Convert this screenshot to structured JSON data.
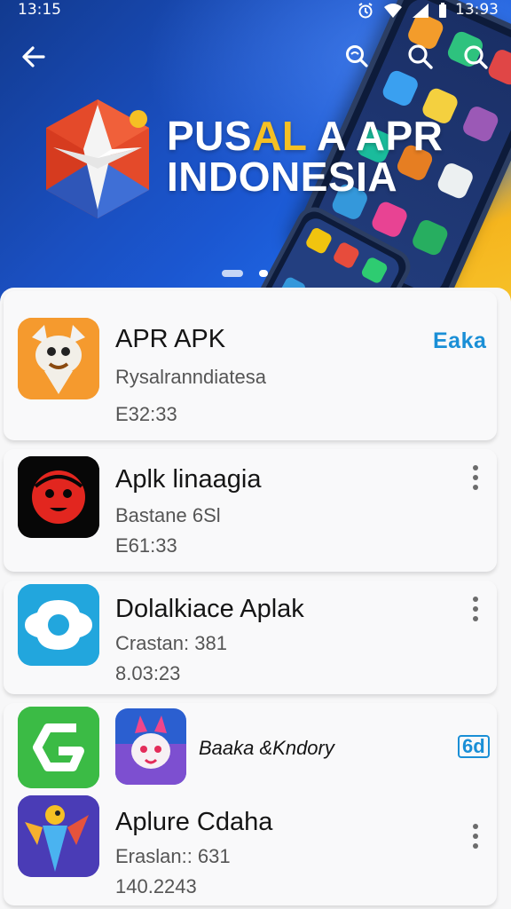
{
  "status_bar": {
    "time_left": "13:15",
    "time_right": "13:93"
  },
  "hero": {
    "title_line1_pre": "PUS",
    "title_line1_hl": "AL",
    "title_line1_post": " A APR",
    "title_line2": "INDONESIA"
  },
  "apps": [
    {
      "name": "APR APK",
      "subtitle": "Rysalranndiatesa",
      "meta": "Е32:33",
      "action": "Eaka",
      "icon": "fox-mascot-icon"
    },
    {
      "name": "Aplk linaagia",
      "subtitle": "Bastane 6Sl",
      "meta": "Е61:33",
      "icon": "red-face-icon"
    },
    {
      "name": "Dolalkiace Aplak",
      "subtitle": "Crastan: 381",
      "meta": "8.03:23",
      "icon": "blue-ring-icon"
    },
    {
      "name": "Baaka &Kndory",
      "action_icon": "6d",
      "icon": "cat-mascot-icon",
      "leading_icon": "green-g-icon"
    },
    {
      "name": "Aplure Cdaha",
      "subtitle": "Eraslan:: 631",
      "meta": "140.2243",
      "icon": "bird-mascot-icon"
    }
  ],
  "colors": {
    "accent": "#1a8fd6",
    "hero_blue": "#1b57d1",
    "hero_yellow": "#f5b51e",
    "title_highlight": "#f5c024"
  }
}
